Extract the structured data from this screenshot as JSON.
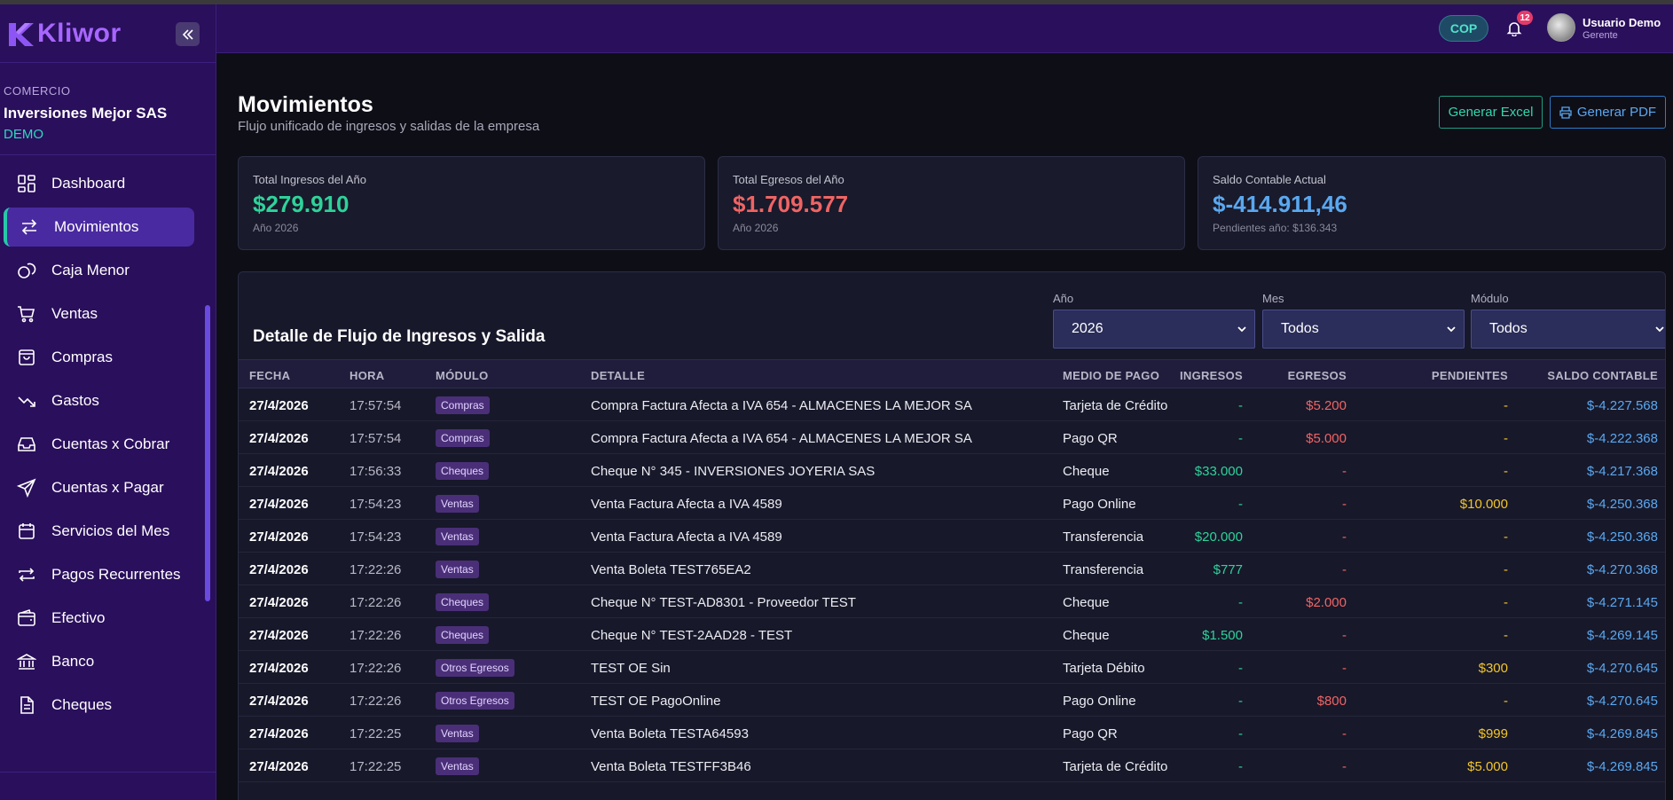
{
  "app": {
    "logo_text": "Kliwor"
  },
  "company": {
    "label": "COMERCIO",
    "name": "Inversiones Mejor SAS",
    "tag": "DEMO"
  },
  "sidebar": {
    "items": [
      {
        "label": "Dashboard",
        "icon": "dashboard-icon"
      },
      {
        "label": "Movimientos",
        "icon": "arrows-exchange-icon"
      },
      {
        "label": "Caja Menor",
        "icon": "coins-icon"
      },
      {
        "label": "Ventas",
        "icon": "cart-icon"
      },
      {
        "label": "Compras",
        "icon": "shopping-bag-icon"
      },
      {
        "label": "Gastos",
        "icon": "trend-down-icon"
      },
      {
        "label": "Cuentas x Cobrar",
        "icon": "inbox-icon"
      },
      {
        "label": "Cuentas x Pagar",
        "icon": "send-icon"
      },
      {
        "label": "Servicios del Mes",
        "icon": "calendar-icon"
      },
      {
        "label": "Pagos Recurrentes",
        "icon": "repeat-icon"
      },
      {
        "label": "Efectivo",
        "icon": "wallet-icon"
      },
      {
        "label": "Banco",
        "icon": "bank-icon"
      },
      {
        "label": "Cheques",
        "icon": "document-icon"
      }
    ],
    "active_index": 1
  },
  "header": {
    "currency": "COP",
    "notifications": "12",
    "user_name": "Usuario Demo",
    "user_role": "Gerente"
  },
  "page": {
    "title": "Movimientos",
    "subtitle": "Flujo unificado de ingresos y salidas de la empresa",
    "excel_label": "Generar Excel",
    "pdf_label": "Generar PDF"
  },
  "cards": [
    {
      "label": "Total Ingresos del Año",
      "value": "$279.910",
      "foot": "Año 2026",
      "color": "#2fd29a"
    },
    {
      "label": "Total Egresos del Año",
      "value": "$1.709.577",
      "foot": "Año 2026",
      "color": "#f06464"
    },
    {
      "label": "Saldo Contable Actual",
      "value": "$-414.911,46",
      "foot": "Pendientes año: $136.343",
      "color": "#5aa8f0"
    }
  ],
  "table": {
    "title": "Detalle de Flujo de Ingresos y Salida",
    "filters": [
      {
        "label": "Año",
        "value": "2026"
      },
      {
        "label": "Mes",
        "value": "Todos"
      },
      {
        "label": "Módulo",
        "value": "Todos"
      }
    ],
    "columns": [
      "FECHA",
      "HORA",
      "MÓDULO",
      "DETALLE",
      "MEDIO DE PAGO",
      "INGRESOS",
      "EGRESOS",
      "PENDIENTES",
      "SALDO CONTABLE"
    ],
    "rows": [
      {
        "fecha": "27/4/2026",
        "hora": "17:57:54",
        "modulo": "Compras",
        "detalle": "Compra Factura Afecta a IVA 654 - ALMACENES LA MEJOR SA",
        "medio": "Tarjeta de Crédito",
        "ingresos": "-",
        "egresos": "$5.200",
        "pendientes": "-",
        "saldo": "$-4.227.568"
      },
      {
        "fecha": "27/4/2026",
        "hora": "17:57:54",
        "modulo": "Compras",
        "detalle": "Compra Factura Afecta a IVA 654 - ALMACENES LA MEJOR SA",
        "medio": "Pago QR",
        "ingresos": "-",
        "egresos": "$5.000",
        "pendientes": "-",
        "saldo": "$-4.222.368"
      },
      {
        "fecha": "27/4/2026",
        "hora": "17:56:33",
        "modulo": "Cheques",
        "detalle": "Cheque N° 345 - INVERSIONES JOYERIA SAS",
        "medio": "Cheque",
        "ingresos": "$33.000",
        "egresos": "-",
        "pendientes": "-",
        "saldo": "$-4.217.368"
      },
      {
        "fecha": "27/4/2026",
        "hora": "17:54:23",
        "modulo": "Ventas",
        "detalle": "Venta Factura Afecta a IVA 4589",
        "medio": "Pago Online",
        "ingresos": "-",
        "egresos": "-",
        "pendientes": "$10.000",
        "saldo": "$-4.250.368"
      },
      {
        "fecha": "27/4/2026",
        "hora": "17:54:23",
        "modulo": "Ventas",
        "detalle": "Venta Factura Afecta a IVA 4589",
        "medio": "Transferencia",
        "ingresos": "$20.000",
        "egresos": "-",
        "pendientes": "-",
        "saldo": "$-4.250.368"
      },
      {
        "fecha": "27/4/2026",
        "hora": "17:22:26",
        "modulo": "Ventas",
        "detalle": "Venta Boleta TEST765EA2",
        "medio": "Transferencia",
        "ingresos": "$777",
        "egresos": "-",
        "pendientes": "-",
        "saldo": "$-4.270.368"
      },
      {
        "fecha": "27/4/2026",
        "hora": "17:22:26",
        "modulo": "Cheques",
        "detalle": "Cheque N° TEST-AD8301 - Proveedor TEST",
        "medio": "Cheque",
        "ingresos": "-",
        "egresos": "$2.000",
        "pendientes": "-",
        "saldo": "$-4.271.145"
      },
      {
        "fecha": "27/4/2026",
        "hora": "17:22:26",
        "modulo": "Cheques",
        "detalle": "Cheque N° TEST-2AAD28 - TEST",
        "medio": "Cheque",
        "ingresos": "$1.500",
        "egresos": "-",
        "pendientes": "-",
        "saldo": "$-4.269.145"
      },
      {
        "fecha": "27/4/2026",
        "hora": "17:22:26",
        "modulo": "Otros Egresos",
        "detalle": "TEST OE Sin",
        "medio": "Tarjeta Débito",
        "ingresos": "-",
        "egresos": "-",
        "pendientes": "$300",
        "saldo": "$-4.270.645"
      },
      {
        "fecha": "27/4/2026",
        "hora": "17:22:26",
        "modulo": "Otros Egresos",
        "detalle": "TEST OE PagoOnline",
        "medio": "Pago Online",
        "ingresos": "-",
        "egresos": "$800",
        "pendientes": "-",
        "saldo": "$-4.270.645"
      },
      {
        "fecha": "27/4/2026",
        "hora": "17:22:25",
        "modulo": "Ventas",
        "detalle": "Venta Boleta TESTA64593",
        "medio": "Pago QR",
        "ingresos": "-",
        "egresos": "-",
        "pendientes": "$999",
        "saldo": "$-4.269.845"
      },
      {
        "fecha": "27/4/2026",
        "hora": "17:22:25",
        "modulo": "Ventas",
        "detalle": "Venta Boleta TESTFF3B46",
        "medio": "Tarjeta de Crédito",
        "ingresos": "-",
        "egresos": "-",
        "pendientes": "$5.000",
        "saldo": "$-4.269.845"
      }
    ]
  },
  "colors": {
    "sidebar_bg": "#2a0f5c",
    "accent_teal": "#27c8a8",
    "income_green": "#2fd29a",
    "expense_red": "#f06464",
    "pending_yellow": "#f2c52a",
    "balance_blue": "#5aa8f0"
  }
}
